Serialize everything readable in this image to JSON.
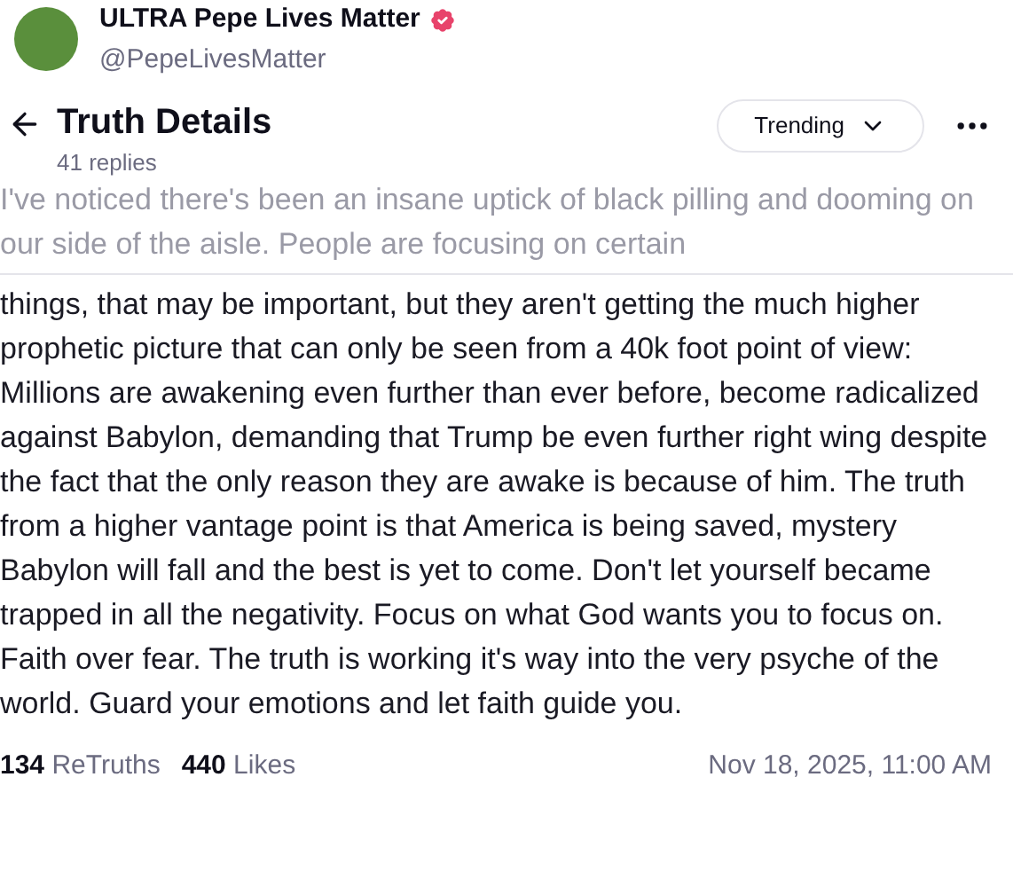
{
  "author": {
    "name": "ULTRA Pepe Lives Matter",
    "handle": "@PepeLivesMatter",
    "verified": true
  },
  "header": {
    "title": "Truth Details",
    "replies": "41 replies",
    "sort": "Trending"
  },
  "faded_text": "I've noticed there's been an insane uptick of black pilling and dooming on our side of the aisle. People are focusing on certain",
  "body": "things, that may be important, but they aren't getting the much higher prophetic picture that can only be seen from a 40k foot point of view: Millions are awakening even further than ever before, become radicalized against Babylon, demanding that Trump be even further right wing despite the fact that the only reason they are awake is because of him. The truth from a higher vantage point is that America is being saved, mystery Babylon will fall and the best is yet to come. Don't let yourself became trapped in all the negativity. Focus on what God wants you to focus on. Faith over fear. The truth is working it's way into the very psyche of the world. Guard your emotions and let faith guide you.",
  "stats": [
    {
      "count": "134",
      "label": "ReTruths"
    },
    {
      "count": "440",
      "label": "Likes"
    }
  ],
  "timestamp": "Nov 18, 2025, 11:00 AM"
}
